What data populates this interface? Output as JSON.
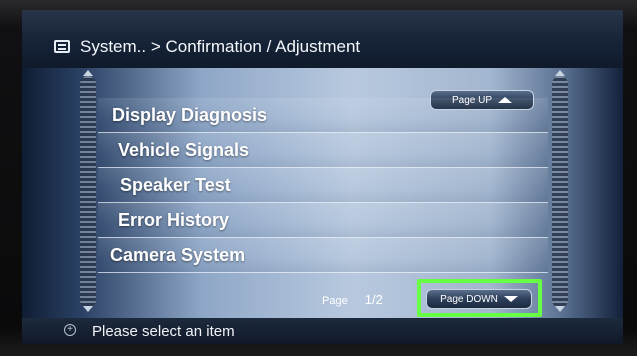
{
  "header": {
    "title": "System.. > Confirmation / Adjustment",
    "icon": "menu-screen-icon"
  },
  "menu": {
    "items": [
      {
        "label": "Display Diagnosis"
      },
      {
        "label": "Vehicle Signals"
      },
      {
        "label": "Speaker Test"
      },
      {
        "label": "Error History"
      },
      {
        "label": "Camera System"
      }
    ]
  },
  "pagination": {
    "page_up_label": "Page UP",
    "page_down_label": "Page DOWN",
    "page_label": "Page",
    "page_number": "1/2"
  },
  "status": {
    "message": "Please select an item",
    "icon": "dial-icon"
  },
  "colors": {
    "highlight": "#66ff44",
    "list_background": "#b8c9df",
    "header_background": "#162337"
  }
}
